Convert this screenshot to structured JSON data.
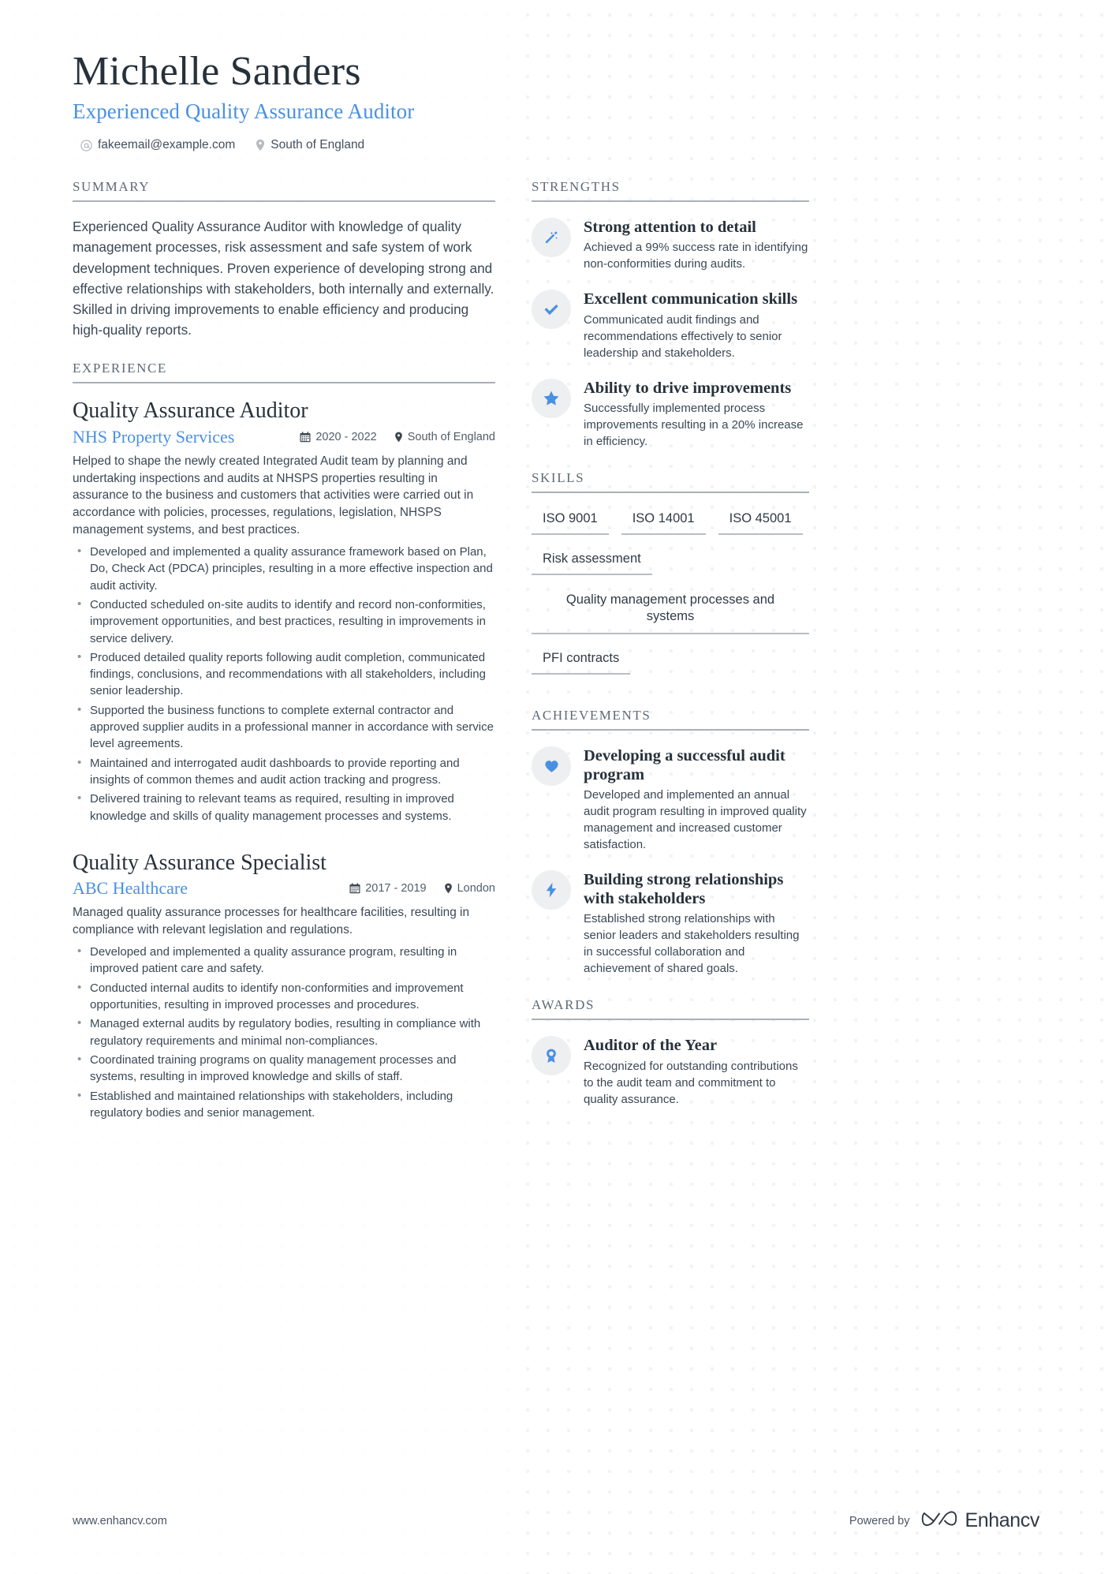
{
  "header": {
    "name": "Michelle Sanders",
    "headline": "Experienced Quality Assurance Auditor",
    "email": "fakeemail@example.com",
    "location": "South of England"
  },
  "summary": {
    "title": "SUMMARY",
    "text": "Experienced Quality Assurance Auditor with knowledge of quality management processes, risk assessment and safe system of work development techniques. Proven experience of developing strong and effective relationships with stakeholders, both internally and externally. Skilled in driving improvements to enable efficiency and producing high-quality reports."
  },
  "experience": {
    "title": "EXPERIENCE",
    "jobs": [
      {
        "title": "Quality Assurance Auditor",
        "company": "NHS Property Services",
        "dates": "2020 - 2022",
        "location": "South of England",
        "description": "Helped to shape the newly created Integrated Audit team by planning and undertaking inspections and audits at NHSPS properties resulting in assurance to the business and customers that activities were carried out in accordance with policies, processes, regulations, legislation, NHSPS management systems, and best practices.",
        "bullets": [
          "Developed and implemented a quality assurance framework based on Plan, Do, Check Act (PDCA) principles, resulting in a more effective inspection and audit activity.",
          "Conducted scheduled on-site audits to identify and record non-conformities, improvement opportunities, and best practices, resulting in improvements in service delivery.",
          "Produced detailed quality reports following audit completion, communicated findings, conclusions, and recommendations with all stakeholders, including senior leadership.",
          "Supported the business functions to complete external contractor and approved supplier audits in a professional manner in accordance with service level agreements.",
          "Maintained and interrogated audit dashboards to provide reporting and insights of common themes and audit action tracking and progress.",
          "Delivered training to relevant teams as required, resulting in improved knowledge and skills of quality management processes and systems."
        ]
      },
      {
        "title": "Quality Assurance Specialist",
        "company": "ABC Healthcare",
        "dates": "2017 - 2019",
        "location": "London",
        "description": "Managed quality assurance processes for healthcare facilities, resulting in compliance with relevant legislation and regulations.",
        "bullets": [
          "Developed and implemented a quality assurance program, resulting in improved patient care and safety.",
          "Conducted internal audits to identify non-conformities and improvement opportunities, resulting in improved processes and procedures.",
          "Managed external audits by regulatory bodies, resulting in compliance with regulatory requirements and minimal non-compliances.",
          "Coordinated training programs on quality management processes and systems, resulting in improved knowledge and skills of staff.",
          "Established and maintained relationships with stakeholders, including regulatory bodies and senior management."
        ]
      }
    ]
  },
  "strengths": {
    "title": "STRENGTHS",
    "items": [
      {
        "icon": "magic-wand-icon",
        "title": "Strong attention to detail",
        "desc": "Achieved a 99% success rate in identifying non-conformities during audits."
      },
      {
        "icon": "check-icon",
        "title": "Excellent communication skills",
        "desc": "Communicated audit findings and recommendations effectively to senior leadership and stakeholders."
      },
      {
        "icon": "star-icon",
        "title": "Ability to drive improvements",
        "desc": "Successfully implemented process improvements resulting in a 20% increase in efficiency."
      }
    ]
  },
  "skills": {
    "title": "SKILLS",
    "items": [
      "ISO 9001",
      "ISO 14001",
      "ISO 45001",
      "Risk assessment",
      "Quality management processes and systems",
      "PFI contracts"
    ]
  },
  "achievements": {
    "title": "ACHIEVEMENTS",
    "items": [
      {
        "icon": "heart-icon",
        "title": "Developing a successful audit program",
        "desc": "Developed and implemented an annual audit program resulting in improved quality management and increased customer satisfaction."
      },
      {
        "icon": "lightning-icon",
        "title": "Building strong relationships with stakeholders",
        "desc": "Established strong relationships with senior leaders and stakeholders resulting in successful collaboration and achievement of shared goals."
      }
    ]
  },
  "awards": {
    "title": "AWARDS",
    "items": [
      {
        "icon": "medal-icon",
        "title": "Auditor of the Year",
        "desc": "Recognized for outstanding contributions to the audit team and commitment to quality assurance."
      }
    ]
  },
  "footer": {
    "url": "www.enhancv.com",
    "powered_by": "Powered by",
    "brand": "Enhancv"
  },
  "colors": {
    "accent": "#4a90e2",
    "text": "#2f3a45",
    "muted": "#5d6a75",
    "badge_bg": "#eeeff0",
    "rule": "#a9b0b7"
  }
}
